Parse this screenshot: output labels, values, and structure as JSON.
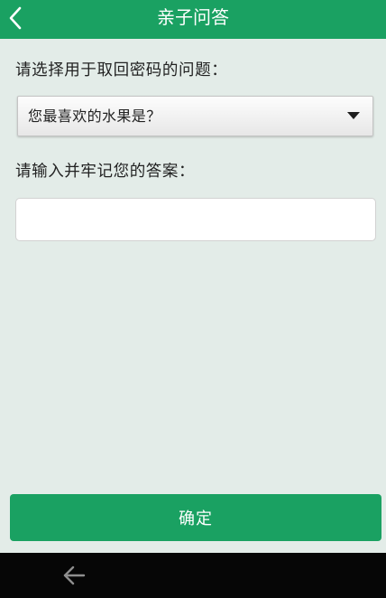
{
  "app_bar": {
    "title": "亲子问答",
    "back_icon": "chevron-left-icon",
    "color": "#1aa162"
  },
  "form": {
    "question_label": "请选择用于取回密码的问题：",
    "question_select": {
      "selected_value": "您最喜欢的水果是？",
      "icon": "triangle-down-icon"
    },
    "answer_label": "请输入并牢记您的答案：",
    "answer_input": {
      "value": "",
      "placeholder": ""
    }
  },
  "confirm_button": {
    "label": "确定",
    "color": "#1aa162"
  },
  "system_nav": {
    "back_icon": "arrow-left-icon"
  }
}
